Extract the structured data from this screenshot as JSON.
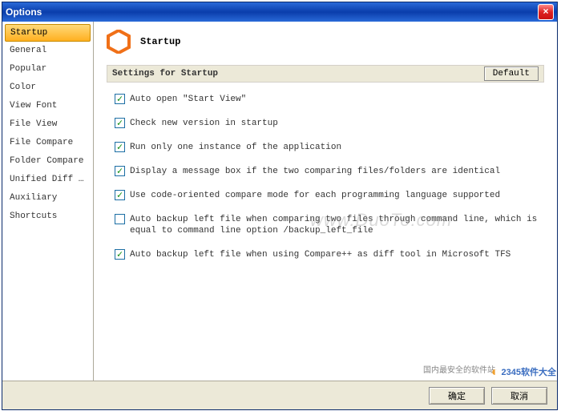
{
  "window": {
    "title": "Options"
  },
  "sidebar": {
    "items": [
      {
        "label": "Startup",
        "selected": true
      },
      {
        "label": "General",
        "selected": false
      },
      {
        "label": "Popular",
        "selected": false
      },
      {
        "label": "Color",
        "selected": false
      },
      {
        "label": "View Font",
        "selected": false
      },
      {
        "label": "File View",
        "selected": false
      },
      {
        "label": "File Compare",
        "selected": false
      },
      {
        "label": "Folder Compare",
        "selected": false
      },
      {
        "label": "Unified Diff ...",
        "selected": false
      },
      {
        "label": "Auxiliary",
        "selected": false
      },
      {
        "label": "Shortcuts",
        "selected": false
      }
    ]
  },
  "header": {
    "title": "Startup"
  },
  "section": {
    "title": "Settings for Startup",
    "default_label": "Default"
  },
  "options": [
    {
      "label": "Auto open \"Start View\"",
      "checked": true
    },
    {
      "label": "Check new version in startup",
      "checked": true
    },
    {
      "label": "Run only one instance of the application",
      "checked": true
    },
    {
      "label": "Display a message box if the two comparing files/folders are identical",
      "checked": true
    },
    {
      "label": "Use code-oriented compare mode for each programming language supported",
      "checked": true
    },
    {
      "label": "Auto backup left file when comparing two files through command line, which is equal to command line option /backup_left_file",
      "checked": false
    },
    {
      "label": "Auto backup left file when using Compare++ as diff tool in Microsoft TFS",
      "checked": true
    }
  ],
  "footer": {
    "ok": "确定",
    "cancel": "取消"
  },
  "watermark": {
    "large": "www.DuoTe.com",
    "small": "国内最安全的软件站",
    "logo": "2345软件大全"
  }
}
